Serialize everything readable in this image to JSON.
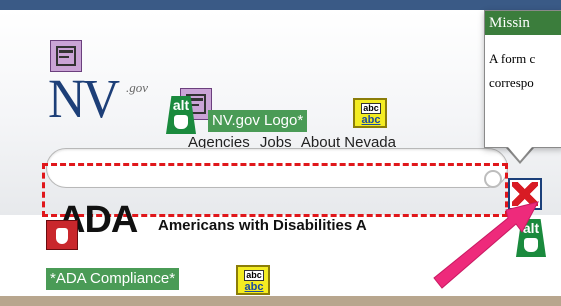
{
  "logo": {
    "main": "NV",
    "suffix": ".gov"
  },
  "alt_label_logo": "NV.gov Logo*",
  "alt_label_ada": "*ADA Compliance*",
  "alt_tag": "alt",
  "abc": {
    "top": "abc",
    "bottom": "abc"
  },
  "nav": {
    "items": [
      "Agencies",
      "Jobs",
      "About Nevada"
    ]
  },
  "callout": {
    "title": "Missin",
    "lines": [
      "A form c",
      "correspo"
    ]
  },
  "ada": {
    "title": "ADA",
    "subtitle": "Americans with Disabilities A"
  },
  "colors": {
    "top_bar": "#3a5a86",
    "callout_header": "#3b7d3c",
    "arrow": "#ee2a7b",
    "error_red": "#d81b24",
    "dashed_outline": "#e0171b"
  }
}
